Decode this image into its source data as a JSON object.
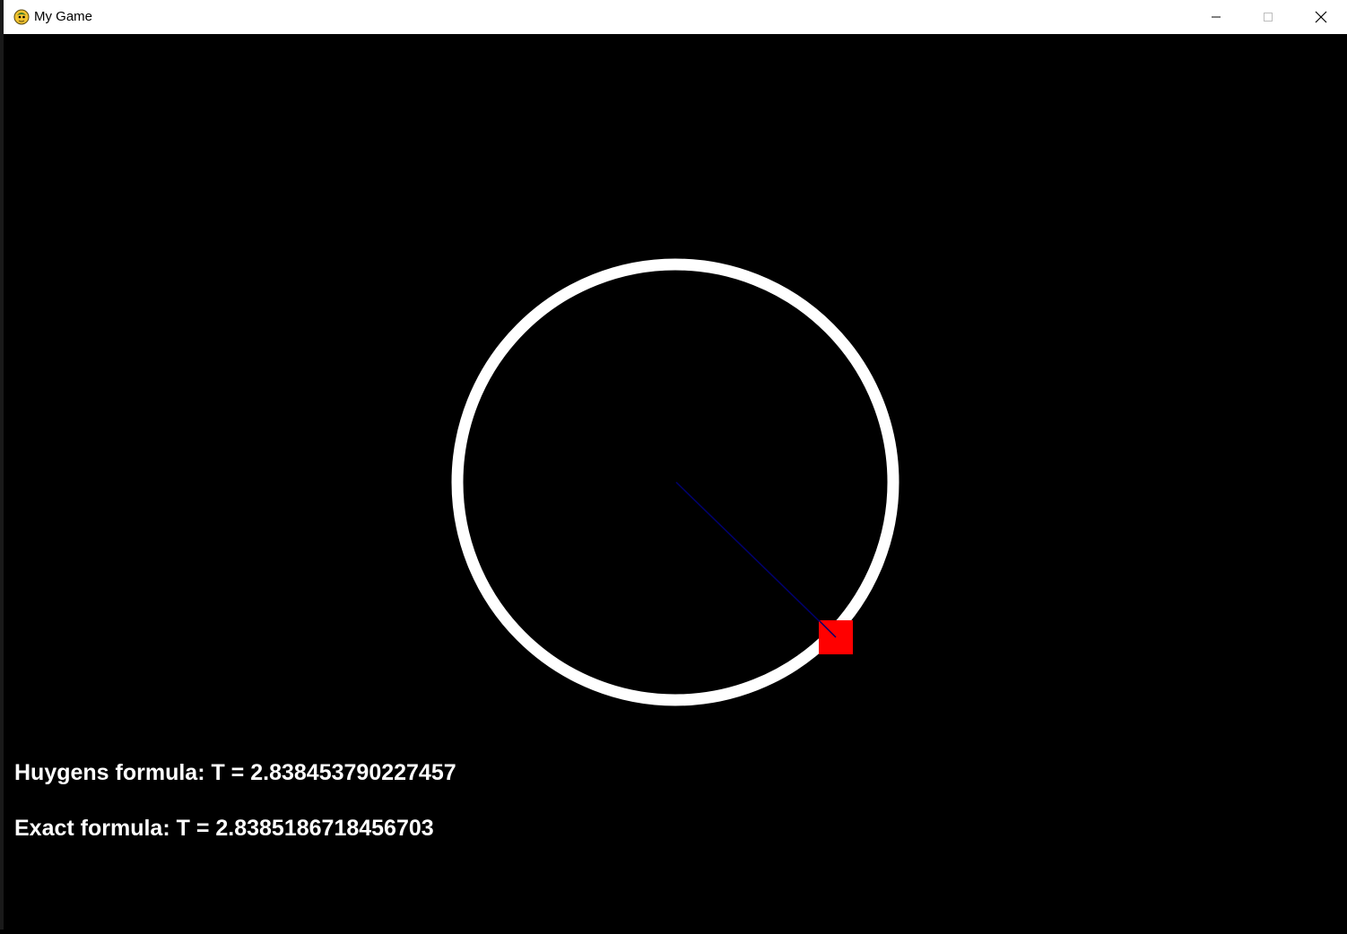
{
  "window": {
    "title": "My Game",
    "app_icon": "pygame-snake-icon",
    "controls": [
      "minimize-icon",
      "maximize-icon",
      "close-icon"
    ]
  },
  "scene": {
    "ring_color": "#ffffff",
    "rod_color": "#00006e",
    "bob_color": "#ff0000",
    "background_color": "#000000"
  },
  "readouts": {
    "huygens": "Huygens formula: T = 2.838453790227457",
    "exact": "Exact formula: T = 2.8385186718456703"
  }
}
